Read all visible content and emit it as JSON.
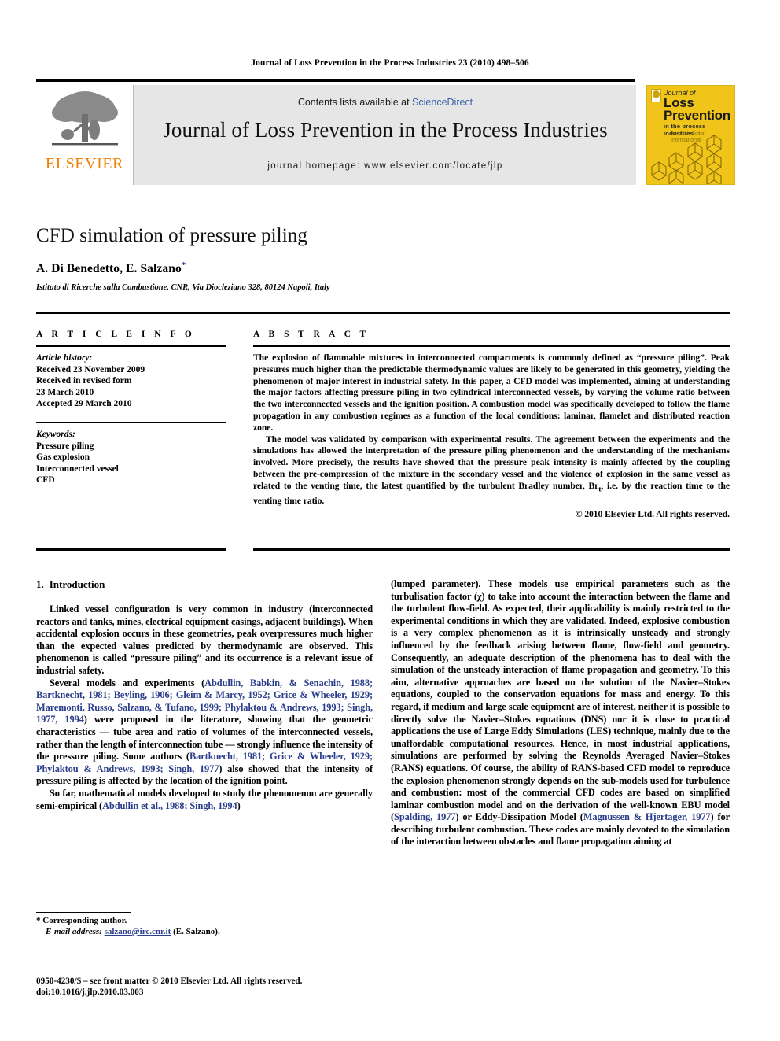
{
  "running_head": "Journal of Loss Prevention in the Process Industries 23 (2010) 498–506",
  "masthead": {
    "publisher_name": "ELSEVIER",
    "contents_prefix": "Contents lists available at ",
    "contents_link": "ScienceDirect",
    "journal_title": "Journal of Loss Prevention in the Process Industries",
    "homepage": "journal homepage: www.elsevier.com/locate/jlp",
    "cover": {
      "line1": "Journal of",
      "line2": "Loss",
      "line3": "Prevention",
      "line4": "in the process industries",
      "line5": "Associate Editor",
      "line6": "International"
    }
  },
  "article": {
    "title": "CFD simulation of pressure piling",
    "authors": "A. Di Benedetto, E. Salzano",
    "corresponding_marker": "*",
    "affiliation": "Istituto di Ricerche sulla Combustione, CNR, Via Diocleziano 328, 80124 Napoli, Italy"
  },
  "article_info": {
    "heading": "A R T I C L E   I N F O",
    "history_label": "Article history:",
    "history": [
      "Received 23 November 2009",
      "Received in revised form",
      "23 March 2010",
      "Accepted 29 March 2010"
    ],
    "keywords_label": "Keywords:",
    "keywords": [
      "Pressure piling",
      "Gas explosion",
      "Interconnected vessel",
      "CFD"
    ]
  },
  "abstract": {
    "heading": "A B S T R A C T",
    "paragraph1": "The explosion of flammable mixtures in interconnected compartments is commonly defined as “pressure piling”. Peak pressures much higher than the predictable thermodynamic values are likely to be generated in this geometry, yielding the phenomenon of major interest in industrial safety. In this paper, a CFD model was implemented, aiming at understanding the major factors affecting pressure piling in two cylindrical interconnected vessels, by varying the volume ratio between the two interconnected vessels and the ignition position. A combustion model was specifically developed to follow the flame propagation in any combustion regimes as a function of the local conditions: laminar, flamelet and distributed reaction zone.",
    "paragraph2_a": "The model was validated by comparison with experimental results. The agreement between the experiments and the simulations has allowed the interpretation of the pressure piling phenomenon and the understanding of the mechanisms involved. More precisely, the results have showed that the pressure peak intensity is mainly affected by the coupling between the pre-compression of the mixture in the secondary vessel and the violence of explosion in the same vessel as related to the venting time, the latest quantified by the turbulent Bradley number, Br",
    "paragraph2_sub": "t",
    "paragraph2_b": ", i.e. by the reaction time to the venting time ratio.",
    "copyright": "© 2010 Elsevier Ltd. All rights reserved."
  },
  "introduction": {
    "number": "1.",
    "heading": "Introduction",
    "p1": "Linked vessel configuration is very common in industry (interconnected reactors and tanks, mines, electrical equipment casings, adjacent buildings). When accidental explosion occurs in these geometries, peak overpressures much higher than the expected values predicted by thermodynamic are observed. This phenomenon is called “pressure piling” and its occurrence is a relevant issue of industrial safety.",
    "p2_a": "Several models and experiments (",
    "p2_refs": "Abdullin, Babkin, & Senachin, 1988; Bartknecht, 1981; Beyling, 1906; Gleim & Marcy, 1952; Grice & Wheeler, 1929; Maremonti, Russo, Salzano, & Tufano, 1999; Phylaktou & Andrews, 1993; Singh, 1977, 1994",
    "p2_b": ") were proposed in the literature, showing that the geometric characteristics — tube area and ratio of volumes of the interconnected vessels, rather than the length of interconnection tube — strongly influence the intensity of the pressure piling. Some authors (",
    "p2_refs2": "Bartknecht, 1981; Grice & Wheeler, 1929; Phylaktou & Andrews, 1993; Singh, 1977",
    "p2_c": ") also showed that the intensity of pressure piling is affected by the location of the ignition point.",
    "p3_a": "So far, mathematical models developed to study the phenomenon are generally semi-empirical (",
    "p3_refs": "Abdullin et al., 1988; Singh, 1994",
    "p3_b": ")"
  },
  "right_column": {
    "p1_a": "(lumped parameter). These models use empirical parameters such as the turbulisation factor (χ) to take into account the interaction between the flame and the turbulent flow-field. As expected, their applicability is mainly restricted to the experimental conditions in which they are validated. Indeed, explosive combustion is a very complex phenomenon as it is intrinsically unsteady and strongly influenced by the feedback arising between flame, flow-field and geometry. Consequently, an adequate description of the phenomena has to deal with the simulation of the unsteady interaction of flame propagation and geometry. To this aim, alternative approaches are based on the solution of the Navier–Stokes equations, coupled to the conservation equations for mass and energy. To this regard, if medium and large scale equipment are of interest, neither it is possible to directly solve the Navier–Stokes equations (DNS) nor it is close to practical applications the use of Large Eddy Simulations (LES) technique, mainly due to the unaffordable computational resources. Hence, in most industrial applications, simulations are performed by solving the Reynolds Averaged Navier–Stokes (RANS) equations. Of course, the ability of RANS-based CFD model to reproduce the explosion phenomenon strongly depends on the sub-models used for turbulence and combustion: most of the commercial CFD codes are based on simplified laminar combustion model and on the derivation of the well-known EBU model (",
    "p1_ref1": "Spalding, 1977",
    "p1_b": ") or Eddy-Dissipation Model (",
    "p1_ref2": "Magnussen & Hjertager, 1977",
    "p1_c": ") for describing turbulent combustion. These codes are mainly devoted to the simulation of the interaction between obstacles and flame propagation aiming at"
  },
  "footnotes": {
    "corresponding": "* Corresponding author.",
    "email_label": "E-mail address:",
    "email": "salzano@irc.cnr.it",
    "email_suffix": "(E. Salzano).",
    "issn_line1": "0950-4230/$ – see front matter © 2010 Elsevier Ltd. All rights reserved.",
    "issn_line2": "doi:10.1016/j.jlp.2010.03.003"
  },
  "colors": {
    "link": "#3b5fa8",
    "reference": "#2b3f8c",
    "elsevier_orange": "#f08000",
    "cover_yellow": "#f0c419",
    "band_gray": "#e6e6e6"
  }
}
